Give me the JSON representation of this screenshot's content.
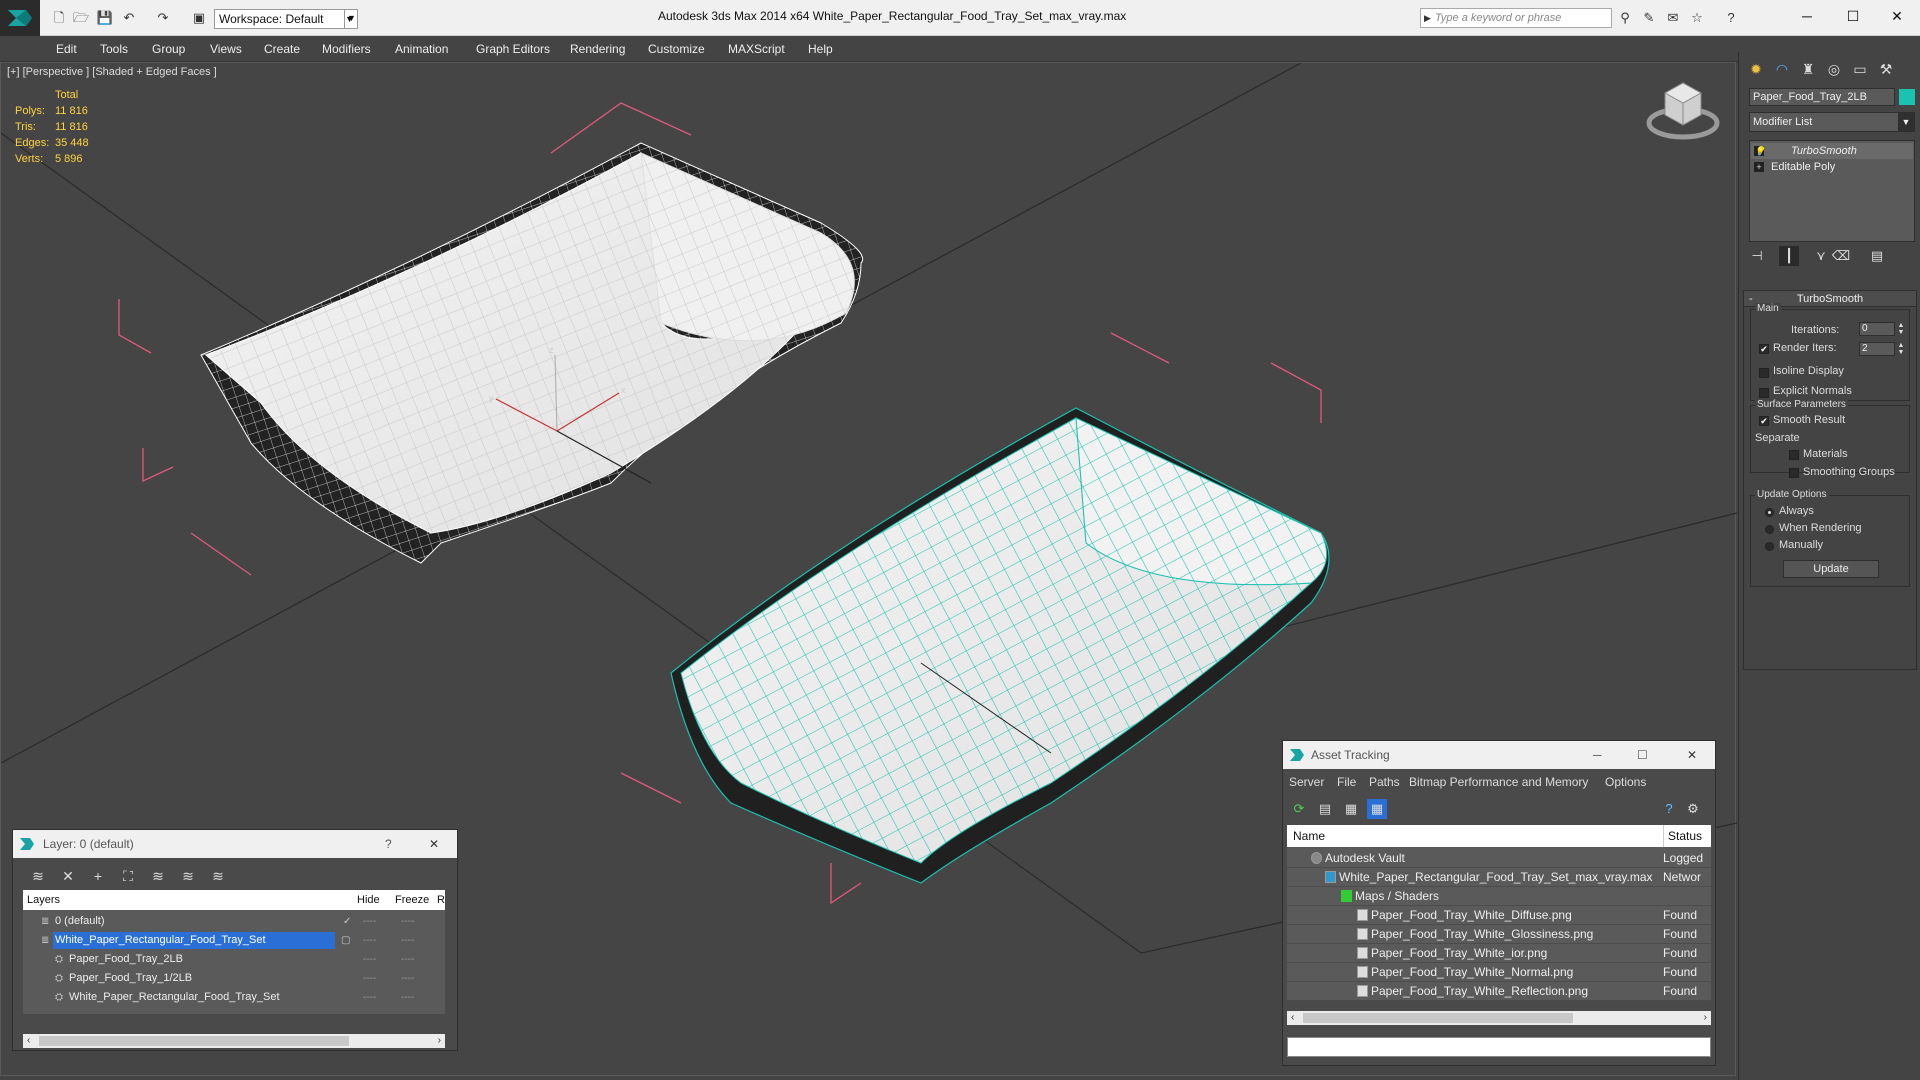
{
  "app": {
    "title": "Autodesk 3ds Max  2014 x64     White_Paper_Rectangular_Food_Tray_Set_max_vray.max",
    "workspace": "Workspace: Default",
    "search_placeholder": "Type a keyword or phrase"
  },
  "menu": [
    "Edit",
    "Tools",
    "Group",
    "Views",
    "Create",
    "Modifiers",
    "Animation",
    "Graph Editors",
    "Rendering",
    "Customize",
    "MAXScript",
    "Help"
  ],
  "viewport": {
    "label": "[+] [Perspective ] [Shaded + Edged Faces ]",
    "stats": {
      "header": "Total",
      "rows": [
        {
          "label": "Polys:",
          "value": "11 816"
        },
        {
          "label": "Tris:",
          "value": "11 816"
        },
        {
          "label": "Edges:",
          "value": "35 448"
        },
        {
          "label": "Verts:",
          "value": "5 896"
        }
      ]
    }
  },
  "command_panel": {
    "object_name": "Paper_Food_Tray_2LB",
    "object_color": "#1ac2b0",
    "modifier_list": "Modifier List",
    "stack": [
      "TurboSmooth",
      "Editable Poly"
    ],
    "turbosmooth": {
      "title": "TurboSmooth",
      "main_label": "Main",
      "iterations_label": "Iterations:",
      "iterations_value": "0",
      "render_iters_label": "Render Iters:",
      "render_iters_value": "2",
      "render_iters_checked": "✔",
      "isoline": "Isoline Display",
      "explicit_normals": "Explicit Normals",
      "surface_params": "Surface Parameters",
      "smooth_result": "Smooth Result",
      "smooth_result_checked": "✔",
      "separate": "Separate",
      "materials": "Materials",
      "smoothing_groups": "Smoothing Groups",
      "update_options": "Update Options",
      "always": "Always",
      "when_rendering": "When Rendering",
      "manually": "Manually",
      "update_button": "Update"
    }
  },
  "layer_dialog": {
    "title": "Layer: 0 (default)",
    "help": "?",
    "close": "✕",
    "columns": [
      "Layers",
      "Hide",
      "Freeze",
      "R"
    ],
    "rows": [
      {
        "name": "0 (default)",
        "indent": 0,
        "selected": false
      },
      {
        "name": "White_Paper_Rectangular_Food_Tray_Set",
        "indent": 0,
        "selected": true
      },
      {
        "name": "Paper_Food_Tray_2LB",
        "indent": 1,
        "selected": false
      },
      {
        "name": "Paper_Food_Tray_1/2LB",
        "indent": 1,
        "selected": false
      },
      {
        "name": "White_Paper_Rectangular_Food_Tray_Set",
        "indent": 1,
        "selected": false
      }
    ],
    "dots": "----"
  },
  "asset_dialog": {
    "title": "Asset Tracking",
    "menu": [
      "Server",
      "File",
      "Paths",
      "Bitmap Performance and Memory",
      "Options"
    ],
    "columns": [
      "Name",
      "Status"
    ],
    "rows": [
      {
        "name": "Autodesk Vault",
        "status": "Logged",
        "indent": 1
      },
      {
        "name": "White_Paper_Rectangular_Food_Tray_Set_max_vray.max",
        "status": "Networ",
        "indent": 2
      },
      {
        "name": "Maps / Shaders",
        "status": "",
        "indent": 3
      },
      {
        "name": "Paper_Food_Tray_White_Diffuse.png",
        "status": "Found",
        "indent": 4
      },
      {
        "name": "Paper_Food_Tray_White_Glossiness.png",
        "status": "Found",
        "indent": 4
      },
      {
        "name": "Paper_Food_Tray_White_ior.png",
        "status": "Found",
        "indent": 4
      },
      {
        "name": "Paper_Food_Tray_White_Normal.png",
        "status": "Found",
        "indent": 4
      },
      {
        "name": "Paper_Food_Tray_White_Reflection.png",
        "status": "Found",
        "indent": 4
      }
    ]
  },
  "colors": {
    "selection_wire": "#1ac2b0",
    "bbox": "#e05a7a",
    "stats_text": "#ffd33f"
  }
}
